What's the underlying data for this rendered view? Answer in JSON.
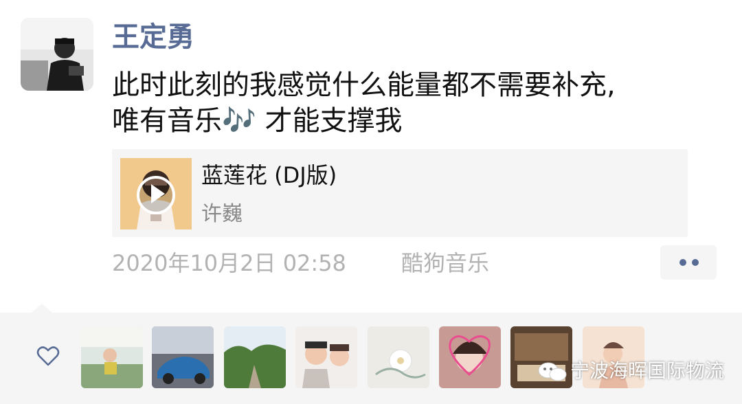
{
  "post": {
    "author": "王定勇",
    "text_line1": "此时此刻的我感觉什么能量都不需要补充,",
    "text_line2": "唯有音乐🎶 才能支撑我",
    "music": {
      "title": "蓝莲花 (DJ版)",
      "artist": "许巍"
    },
    "timestamp": "2020年10月2日 02:58",
    "source": "酷狗音乐"
  },
  "icons": {
    "more": "more-dots-icon",
    "like": "heart-outline-icon",
    "play": "play-icon",
    "wechat": "wechat-logo-icon"
  },
  "likes": {
    "count": 8
  },
  "watermark": "宁波海晖国际物流",
  "colors": {
    "link_blue": "#576b95",
    "meta_gray": "#b2b2b2",
    "panel_bg": "#f5f5f5"
  }
}
